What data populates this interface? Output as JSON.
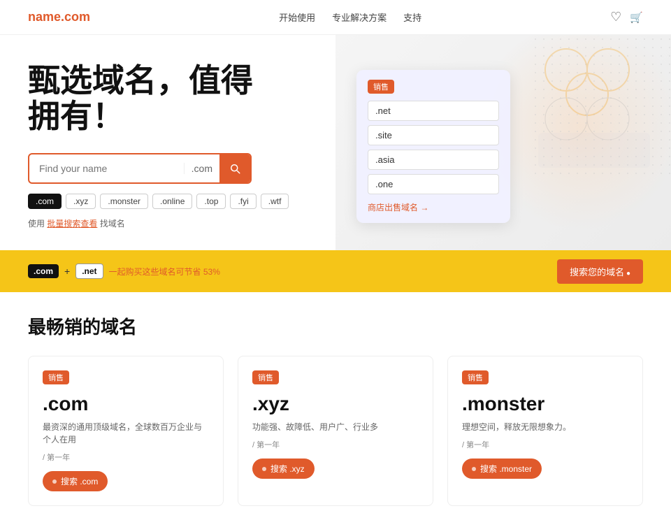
{
  "navbar": {
    "logo": "name",
    "logo_tld": ".com",
    "links": [
      "开始使用",
      "专业解决方案",
      "支持"
    ],
    "icon_heart": "♡",
    "icon_cart": "🛒"
  },
  "hero": {
    "title_line1": "甄选域名，值得",
    "title_line2": "拥有！",
    "search_placeholder": "Find your name",
    "search_tld": ".com",
    "tld_tags": [
      ".com",
      ".xyz",
      ".monster",
      ".online",
      ".top",
      ".fyi",
      ".wtf"
    ],
    "active_tag": ".com",
    "bulk_prefix": "使用",
    "bulk_link_text": "批量搜索查看",
    "bulk_suffix": "找域名"
  },
  "domain_panel": {
    "badge": "销售",
    "domains": [
      ".net",
      ".site",
      ".asia",
      ".one"
    ],
    "shop_link": "商店出售域名 →"
  },
  "yellow_banner": {
    "badge_com": ".com",
    "plus": "+",
    "badge_net": ".net",
    "note": "一起购买这些域名可节省 53%",
    "search_btn": "搜索您的域名"
  },
  "popular_section": {
    "title": "最畅销的域名",
    "cards": [
      {
        "badge": "销售",
        "tld": ".com",
        "desc": "最资深的通用顶级域名，全球数百万企业与个人在用",
        "year": "/ 第一年",
        "btn": "搜索 .com"
      },
      {
        "badge": "销售",
        "tld": ".xyz",
        "desc": "功能强、故障低、用户广、行业多",
        "year": "/ 第一年",
        "btn": "搜索 .xyz"
      },
      {
        "badge": "销售",
        "tld": ".monster",
        "desc": "理想空间，释放无限想象力。",
        "year": "/ 第一年",
        "btn": "搜索 .monster"
      }
    ]
  }
}
